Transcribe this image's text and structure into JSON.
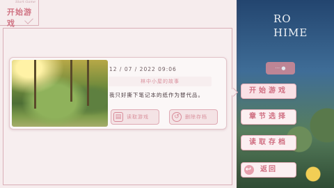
{
  "background": {
    "title_lines": [
      "RO",
      "HIME"
    ],
    "pill_text": "··· ●"
  },
  "panel": {
    "tab_title": "开始游戏",
    "tab_script": "Start Game"
  },
  "save_slot": {
    "date": "12 / 07 / 2022  09:06",
    "title": "林中小屋的故事",
    "text": "我只好撕下笔记本的纸作为替代品。",
    "buttons": {
      "load_label": "读取游戏",
      "delete_label": "删除存档"
    }
  },
  "menu": {
    "start": "开始游戏",
    "chapter": "章节选择",
    "load": "读取存档",
    "back": "返回"
  },
  "colors": {
    "accent": "#d06f82",
    "panel_bg": "#f6eced",
    "border": "#d9aeb7"
  }
}
